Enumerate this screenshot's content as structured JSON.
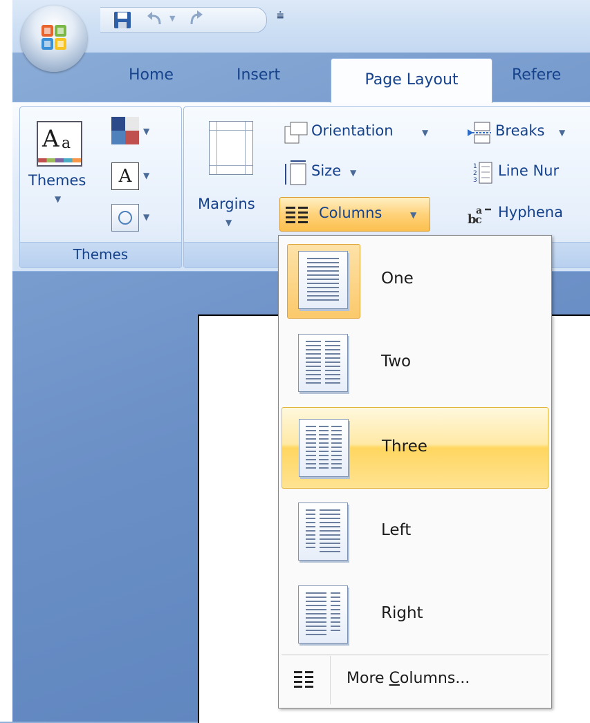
{
  "tabs": [
    {
      "label": "Home"
    },
    {
      "label": "Insert"
    },
    {
      "label": "Page Layout"
    },
    {
      "label": "Refere"
    }
  ],
  "ribbon": {
    "themes_group": {
      "themes_label": "Themes",
      "group_label": "Themes",
      "font_letter": "A"
    },
    "page_setup_group": {
      "margins_label": "Margins",
      "orientation_label": "Orientation",
      "size_label": "Size",
      "columns_label": "Columns",
      "breaks_label": "Breaks",
      "line_numbers_label": "Line Nur",
      "hyphenation_label": "Hyphena"
    }
  },
  "columns_menu": {
    "items": [
      {
        "label": "One",
        "state": "selected"
      },
      {
        "label": "Two",
        "state": "normal"
      },
      {
        "label": "Three",
        "state": "hover"
      },
      {
        "label": "Left",
        "state": "normal"
      },
      {
        "label": "Right",
        "state": "normal"
      }
    ],
    "more_label_prefix": "More ",
    "more_label_mnemonic": "C",
    "more_label_suffix": "olumns..."
  },
  "colors": {
    "tab_text": "#15428b",
    "hover_gold": "#ffd660",
    "selected_orange": "#fbc96b"
  }
}
